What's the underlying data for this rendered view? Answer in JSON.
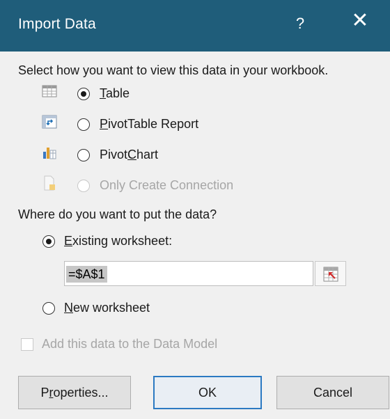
{
  "dialog": {
    "title": "Import Data",
    "help_glyph": "?",
    "close_glyph": "✕"
  },
  "view_section": {
    "prompt": "Select how you want to view this data in your workbook.",
    "options": [
      {
        "key": "T",
        "rest": "able",
        "icon": "table-icon",
        "selected": true,
        "enabled": true
      },
      {
        "key": "P",
        "rest": "ivotTable Report",
        "icon": "pivottable-icon",
        "selected": false,
        "enabled": true
      },
      {
        "pre": "Pivot",
        "key": "C",
        "rest": "hart",
        "icon": "pivotchart-icon",
        "selected": false,
        "enabled": true
      },
      {
        "label": "Only Create Connection",
        "icon": "connection-icon",
        "selected": false,
        "enabled": false
      }
    ]
  },
  "location_section": {
    "prompt": "Where do you want to put the data?",
    "existing": {
      "key": "E",
      "rest": "xisting worksheet:",
      "selected": true
    },
    "range_value": "=$A$1",
    "new": {
      "key": "N",
      "rest": "ew worksheet",
      "selected": false
    }
  },
  "data_model": {
    "label": "Add this data to the Data Model",
    "checked": false,
    "enabled": false
  },
  "buttons": {
    "properties": {
      "pre": "P",
      "key": "r",
      "rest": "operties..."
    },
    "ok": "OK",
    "cancel": "Cancel"
  },
  "colors": {
    "titlebar": "#1f5d7a",
    "background": "#f0f0f0",
    "default_button_border": "#2b79c2"
  }
}
